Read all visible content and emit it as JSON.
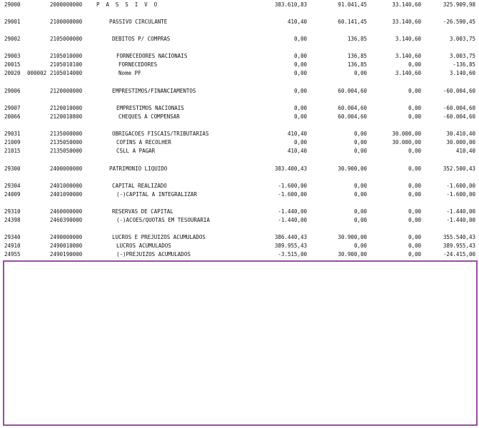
{
  "colors": {
    "frame_border": "#9b4aa6",
    "text": "#111111",
    "background": "#ffffff"
  },
  "rows": [
    {
      "id": "29000",
      "sub": "",
      "account": "2000000000",
      "desc": "P A S S I V O",
      "v1": "383.610,83",
      "v2": "91.041,45",
      "v3": "33.140,60",
      "v4": "325.909,98",
      "level": 0
    },
    {
      "id": "29001",
      "sub": "",
      "account": "2100000000",
      "desc": "PASSIVO CIRCULANTE",
      "v1": "410,40",
      "v2": "60.141,45",
      "v3": "33.140,60",
      "v4": "-26.590,45",
      "level": 1
    },
    {
      "id": "29002",
      "sub": "",
      "account": "2105000000",
      "desc": "DEBITOS P/ COMPRAS",
      "v1": "0,00",
      "v2": "136,85",
      "v3": "3.140,60",
      "v4": "3.003,75",
      "level": 2
    },
    {
      "id": "29003",
      "sub": "",
      "account": "2105010000",
      "desc": "FORNECEDORES NACIONAIS",
      "v1": "0,00",
      "v2": "136,85",
      "v3": "3.140,60",
      "v4": "3.003,75",
      "level": 3
    },
    {
      "id": "20015",
      "sub": "",
      "account": "2105010100",
      "desc": "FORNECEDORES",
      "v1": "0,00",
      "v2": "136,85",
      "v3": "0,00",
      "v4": "-136,85",
      "level": 4
    },
    {
      "id": "20020",
      "sub": "000002",
      "account": "2105014000",
      "desc": "Nome PF",
      "v1": "0,00",
      "v2": "0,00",
      "v3": "3.140,60",
      "v4": "3.140,60",
      "level": 4
    },
    {
      "id": "29006",
      "sub": "",
      "account": "2120000000",
      "desc": "EMPRESTIMOS/FINANCIAMENTOS",
      "v1": "0,00",
      "v2": "60.004,60",
      "v3": "0,00",
      "v4": "-60.004,60",
      "level": 2
    },
    {
      "id": "29007",
      "sub": "",
      "account": "2120010000",
      "desc": "EMPRESTIMOS NACIONAIS",
      "v1": "0,00",
      "v2": "60.004,60",
      "v3": "0,00",
      "v4": "-60.004,60",
      "level": 3
    },
    {
      "id": "20066",
      "sub": "",
      "account": "2120010800",
      "desc": "CHEQUES A COMPENSAR",
      "v1": "0,00",
      "v2": "60.004,60",
      "v3": "0,00",
      "v4": "-60.004,60",
      "level": 4
    },
    {
      "id": "29031",
      "sub": "",
      "account": "2135000000",
      "desc": "OBRIGACOES FISCAIS/TRIBUTARIAS",
      "v1": "410,40",
      "v2": "0,00",
      "v3": "30.000,00",
      "v4": "30.410,40",
      "level": 2
    },
    {
      "id": "21009",
      "sub": "",
      "account": "2135050000",
      "desc": "COFINS A RECOLHER",
      "v1": "0,00",
      "v2": "0,00",
      "v3": "30.000,00",
      "v4": "30.000,00",
      "level": 3
    },
    {
      "id": "21015",
      "sub": "",
      "account": "2135050000",
      "desc": "CSLL A PAGAR",
      "v1": "410,40",
      "v2": "0,00",
      "v3": "0,00",
      "v4": "410,40",
      "level": 3
    },
    {
      "id": "29300",
      "sub": "",
      "account": "2400000000",
      "desc": "PATRIMONIO LIQUIDO",
      "v1": "383.400,43",
      "v2": "30.900,00",
      "v3": "0,00",
      "v4": "352.500,43",
      "level": 1
    },
    {
      "id": "29304",
      "sub": "",
      "account": "2401000000",
      "desc": "CAPITAL REALIZADO",
      "v1": "-1.600,00",
      "v2": "0,00",
      "v3": "0,00",
      "v4": "-1.600,00",
      "level": 2
    },
    {
      "id": "24009",
      "sub": "",
      "account": "2401090000",
      "desc": "(-)CAPITAL A INTEGRALIZAR",
      "v1": "-1.600,00",
      "v2": "0,00",
      "v3": "0,00",
      "v4": "-1.600,00",
      "level": 3
    },
    {
      "id": "29310",
      "sub": "",
      "account": "2460000000",
      "desc": "RESERVAS DE CAPITAL",
      "v1": "-1.440,00",
      "v2": "0,00",
      "v3": "0,00",
      "v4": "-1.440,00",
      "level": 2
    },
    {
      "id": "24398",
      "sub": "",
      "account": "2460390000",
      "desc": "(-)ACOES/QUOTAS EM TESOURARIA",
      "v1": "-1.440,00",
      "v2": "0,00",
      "v3": "0,00",
      "v4": "-1.440,00",
      "level": 3
    },
    {
      "id": "29340",
      "sub": "",
      "account": "2490000000",
      "desc": "LUCROS E PREJUIZOS ACUMULADOS",
      "v1": "386.440,43",
      "v2": "30.900,00",
      "v3": "0,00",
      "v4": "355.540,43",
      "level": 2
    },
    {
      "id": "24910",
      "sub": "",
      "account": "2490010000",
      "desc": "LUCROS ACUMULADOS",
      "v1": "389.955,43",
      "v2": "0,00",
      "v3": "0,00",
      "v4": "389.955,43",
      "level": 3
    },
    {
      "id": "24955",
      "sub": "",
      "account": "2490190000",
      "desc": "(-)PREJUIZOS ACUMULADOS",
      "v1": "-3.515,00",
      "v2": "30.900,00",
      "v3": "0,00",
      "v4": "-24.415,00",
      "level": 3
    }
  ]
}
